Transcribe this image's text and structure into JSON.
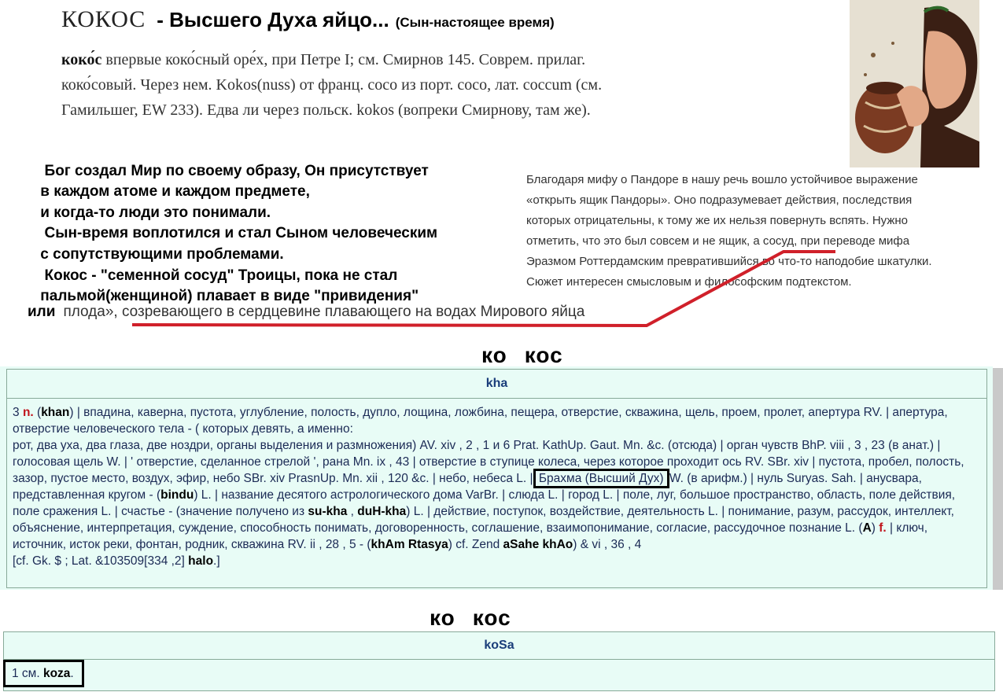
{
  "title": {
    "word": "КОКОС",
    "main": "- Высшего Духа яйцо...",
    "note": "(Сын-настоящее время)"
  },
  "etymology": {
    "head": "коко́с",
    "line1_rest": " впервые коко́сный оре́х, при Петре I; см. Смирнов 145. Соврем. прилаг.",
    "line2": "коко́совый. Через нем. Kokos(nuss) от франц. coco из порт. coco, лат. coccum (см.",
    "line3": "Гамильшег, EW 233). Едва ли через польск. kokos (вопреки Смирнову, там же)."
  },
  "bold_paragraph": {
    "l1": "  Бог создал Мир по своему образу, Он присутствует",
    "l2": " в каждом атоме и каждом предмете,",
    "l3": " и когда-то люди это понимали.",
    "l4": "  Сын-время воплотился и стал Сыном человеческим",
    "l5": " с сопутствующими проблемами.",
    "l6": "  Кокос - \"семенной сосуд\" Троицы, пока не стал",
    "l7": " пальмой(женщиной) плавает в виде \"привидения\""
  },
  "ili_line": {
    "bold": "или",
    "rest": "плода», созревающего в сердцевине плавающего на водах Мирового яйца"
  },
  "pandora": {
    "l1": "Благодаря мифу о Пандоре в нашу речь вошло устойчивое выражение",
    "l2": "«открыть ящик Пандоры». Оно подразумевает действия, последствия",
    "l3": "которых отрицательны, к тому же их нельзя повернуть вспять. Нужно",
    "l4a": "отметить, что это был совсем и не ящик, ",
    "l4b": "а сосуд",
    "l4c": ", при переводе мифа",
    "l5": "Эразмом Роттердамским превратившийся во что-то наподобие шкатулки.",
    "l6": "Сюжет интересен смысловым и философским подтекстом."
  },
  "heading1": {
    "a": "ко",
    "b": "кос"
  },
  "heading2": {
    "a": "ко",
    "b": "кос"
  },
  "dict1": {
    "header": "kha",
    "t01": "3 ",
    "t02": "n.",
    "t03": " (",
    "t04": "khan",
    "t05": ") | впадина, каверна, пустота, углубление, полость, дупло, лощина, ложбина, пещера, отверстие, скважина, щель, проем, пролет, апертура RV. | апертура, отверстие человеческого тела - ( которых девять, а именно:",
    "t06": "рот, два уха, два глаза, две ноздри, органы выделения и размножения) AV. xiv , 2 , 1 и 6 Prat. KathUp. Gaut. Mn. &c. (отсюда) | орган чувств BhP. viii , 3 , 23 (в анат.) | голосовая щель W. | ' отверстие, сделанное стрелой ', рана Mn. ix , 43 | отверстие в ступице колеса, через которое проходит ось RV. SBr. xiv | пустота, пробел, полость, зазор, пустое место, воздух, эфир, небо SBr. xiv PrasnUp. Mn. xii , 120 &c. | небо, небеса L. | ",
    "t07": "Брахма (Высший Дух)",
    "t08": " W. (в арифм.) | нуль Suryas. Sah. | анусвара, представленная кругом - (",
    "t09": "bindu",
    "t10": ") L. | название десятого астрологического дома VarBr. | слюда L. | город L. | поле, луг, большое пространство, область, поле действия, поле сражения L. | счастье - (значение получено из ",
    "t11": "su-kha",
    "t12": " , ",
    "t13": "duH-kha",
    "t14": ") L. | действие, поступок, воздействие, деятельность L. | понимание, разум, рассудок, интеллект, объяснение, интерпретация, суждение, способность понимать, договоренность, соглашение, взаимопонимание, согласие, рассудочное познание L. (",
    "t15": "A",
    "t16": ") ",
    "t17": "f.",
    "t18": " | ключ, источник, исток реки, фонтан, родник, скважина RV. ii , 28 , 5 - (",
    "t19": "khAm Rtasya",
    "t20": ") cf. Zend ",
    "t21": "aSahe khAo",
    "t22": ") & vi , 36 , 4",
    "t23": "[cf. Gk. $ ; Lat. &103509[334 ,2] ",
    "t24": "halo",
    "t25": ".]"
  },
  "dict2": {
    "header": "koSa",
    "t1": "1 см. ",
    "t2": "koza",
    "t3": "."
  },
  "colors": {
    "table_bg": "#e8fcf6",
    "header_text": "#1a3d7a",
    "red_mark": "#c0141c",
    "red_line": "#d0202a"
  }
}
